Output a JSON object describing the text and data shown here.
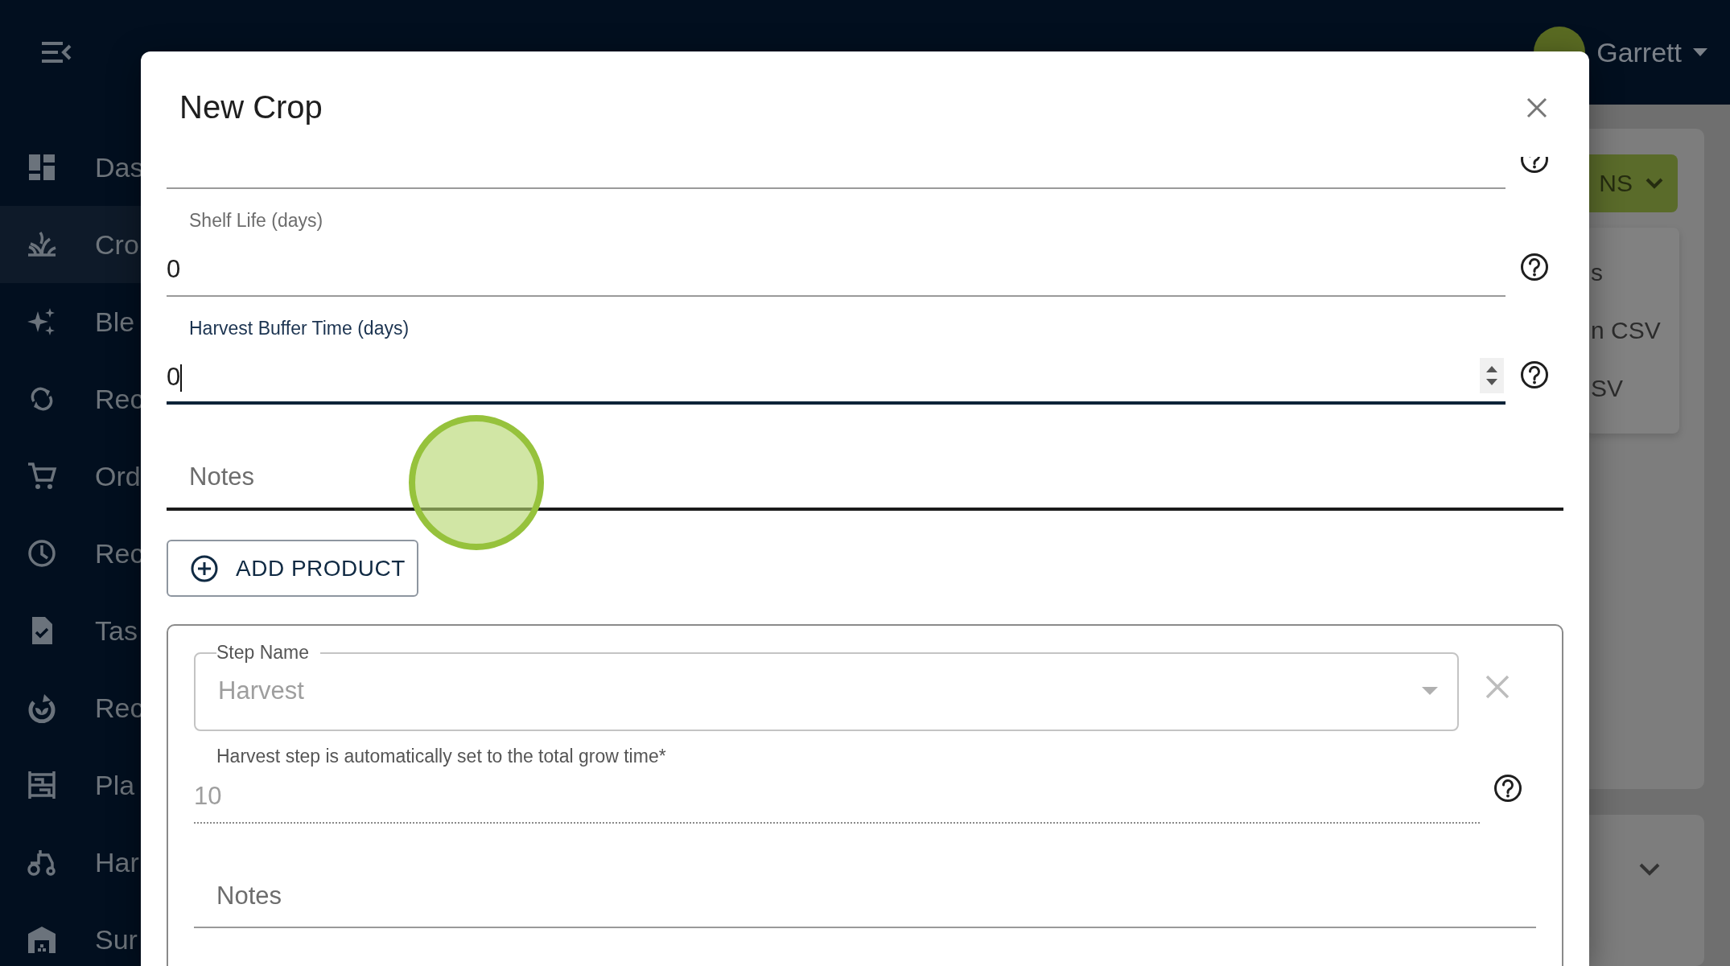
{
  "app_bar": {
    "user": {
      "name": "Garrett"
    }
  },
  "sidebar": {
    "items": [
      {
        "label": "Das",
        "selected": false
      },
      {
        "label": "Cro",
        "selected": true
      },
      {
        "label": "Ble",
        "selected": false
      },
      {
        "label": "Rec",
        "selected": false
      },
      {
        "label": "Ord",
        "selected": false
      },
      {
        "label": "Rec",
        "selected": false
      },
      {
        "label": "Tas",
        "selected": false
      },
      {
        "label": "Rec",
        "selected": false
      },
      {
        "label": "Pla",
        "selected": false
      },
      {
        "label": "Har",
        "selected": false
      },
      {
        "label": "Sur",
        "selected": false
      }
    ]
  },
  "page": {
    "actions_button": "NS",
    "menu_items": [
      "s",
      "n CSV",
      "SV"
    ]
  },
  "dialog": {
    "title": "New Crop",
    "fields": [
      {
        "kind": "number",
        "help": true,
        "focused": false
      },
      {
        "kind": "number",
        "label": "Shelf Life (days)",
        "value": "0",
        "help": true,
        "focused": false
      },
      {
        "kind": "number",
        "label": "Harvest Buffer Time (days)",
        "value": "0",
        "help": true,
        "focused": true
      },
      {
        "kind": "textarea",
        "placeholder": "Notes"
      }
    ],
    "add_button": "ADD PRODUCT",
    "steps": [
      {
        "label": "Step Name",
        "value": "Harvest",
        "disabled": true,
        "helper": "Harvest step is automatically set to the total grow time*",
        "duration": "10",
        "notes_placeholder": "Notes"
      }
    ]
  }
}
